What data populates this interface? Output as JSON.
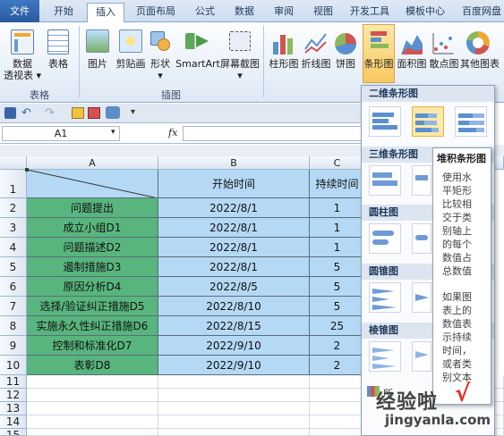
{
  "tabs": [
    "文件",
    "开始",
    "插入",
    "页面布局",
    "公式",
    "数据",
    "审阅",
    "视图",
    "开发工具",
    "模板中心",
    "百度网盘"
  ],
  "ribbon": {
    "pivot_label": "数据\n透视表",
    "pivot_label_1": "数据",
    "pivot_label_2": "透视表 ▾",
    "table_label": "表格",
    "picture_label": "图片",
    "clipart_label": "剪贴画",
    "shapes_label": "形状",
    "shapes_arrow": "▾",
    "smartart_label": "SmartArt",
    "screenshot_label": "屏幕截图",
    "screenshot_arrow": "▾",
    "column_label": "柱形图",
    "line_label": "折线图",
    "pie_label": "饼图",
    "bar_label": "条形图",
    "area_label": "面积图",
    "scatter_label": "散点图",
    "other_label": "其他图表",
    "group_tables": "表格",
    "group_illustrations": "插图"
  },
  "namebox": "A1",
  "fx": "fx",
  "columns": [
    "A",
    "B",
    "C"
  ],
  "headers": {
    "b": "开始时间",
    "c": "持续时间"
  },
  "rows": [
    {
      "a": "问题提出",
      "b": "2022/8/1",
      "c": "1"
    },
    {
      "a": "成立小组D1",
      "b": "2022/8/1",
      "c": "1"
    },
    {
      "a": "问题描述D2",
      "b": "2022/8/1",
      "c": "1"
    },
    {
      "a": "遏制措施D3",
      "b": "2022/8/1",
      "c": "5"
    },
    {
      "a": "原因分析D4",
      "b": "2022/8/5",
      "c": "5"
    },
    {
      "a": "选择/验证纠正措施D5",
      "b": "2022/8/10",
      "c": "5"
    },
    {
      "a": "实施永久性纠正措施D6",
      "b": "2022/8/15",
      "c": "25"
    },
    {
      "a": "控制和标准化D7",
      "b": "2022/9/10",
      "c": "2"
    },
    {
      "a": "表彰D8",
      "b": "2022/9/10",
      "c": "2"
    }
  ],
  "row_numbers": [
    "1",
    "2",
    "3",
    "4",
    "5",
    "6",
    "7",
    "8",
    "9",
    "10",
    "11",
    "12",
    "13",
    "14",
    "15"
  ],
  "dropdown": {
    "section_2d": "二维条形图",
    "section_3d": "三维条形图",
    "section_cyl": "圆柱图",
    "section_cone": "圆锥图",
    "section_pyr": "棱锥图",
    "all_charts_label": "所"
  },
  "tooltip": {
    "title": "堆积条形图",
    "body1": "使用水平矩形比较相交于类别轴上的每个数值占总数值",
    "body1_lines": [
      "使用水",
      "平矩形",
      "比较相",
      "交于类",
      "别轴上",
      "的每个",
      "数值占",
      "总数值"
    ],
    "body2_lines": [
      "如果图",
      "表上的",
      "数值表",
      "示持续",
      "时间，",
      "或者类",
      "别文本"
    ]
  },
  "watermark": {
    "cn": "经验啦",
    "check": "√",
    "url": "jingyanla.com"
  },
  "colors": {
    "green": "#58b57d",
    "blue": "#b5d9f5",
    "accent": "#2a5a9c"
  }
}
